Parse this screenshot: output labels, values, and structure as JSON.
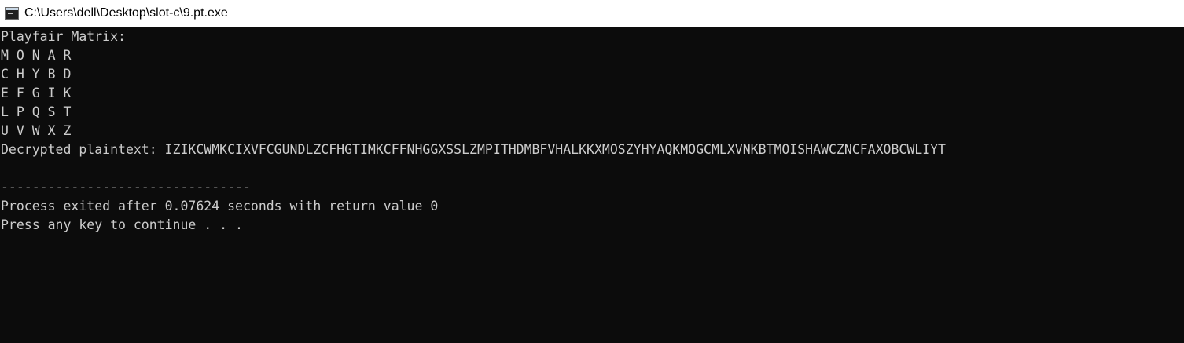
{
  "window": {
    "title": "C:\\Users\\dell\\Desktop\\slot-c\\9.pt.exe"
  },
  "console": {
    "heading": "Playfair Matrix:",
    "matrix_rows": [
      "M O N A R",
      "C H Y B D",
      "E F G I K",
      "L P Q S T",
      "U V W X Z"
    ],
    "decrypted_line": "Decrypted plaintext: IZIKCWMKCIXVFCGUNDLZCFHGTIMKCFFNHGGXSSLZMPITHDMBFVHALKKXMOSZYHYAQKMOGCMLXVNKBTMOISHAWCZNCFAXOBCWLIYT",
    "blank_line": "",
    "separator": "--------------------------------",
    "exit_message": "Process exited after 0.07624 seconds with return value 0",
    "continue_prompt": "Press any key to continue . . ."
  },
  "colors": {
    "background": "#0c0c0c",
    "text": "#cccccc",
    "titlebar": "#ffffff"
  },
  "icons": {
    "app": "console-app-icon"
  }
}
